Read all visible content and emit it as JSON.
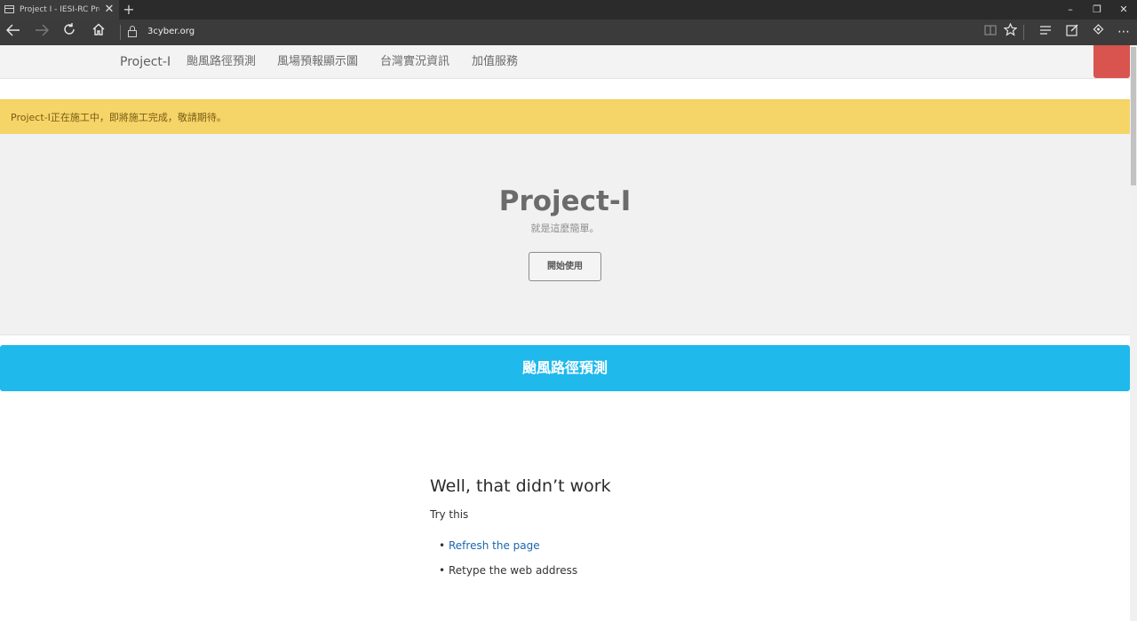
{
  "browser": {
    "tab_title": "Project I - IESI-RC Produ",
    "tab_close": "✕",
    "new_tab": "+",
    "url": "3cyber.org",
    "window_controls": {
      "minimize": "–",
      "restore": "❐",
      "close": "✕"
    },
    "icons": {
      "back": "🡐",
      "forward": "🡒",
      "refresh": "↻",
      "home": "⌂",
      "reading_view": "▯",
      "favorite": "☆",
      "hub": "≡",
      "web_note": "✎",
      "share": "⟲",
      "more": "⋯"
    }
  },
  "site_nav": {
    "brand": "Project-I",
    "items": [
      "颱風路徑預測",
      "風場預報顯示圖",
      "台灣實況資訊",
      "加值服務"
    ]
  },
  "alert": {
    "text": "Project-I正在施工中，即將施工完成，敬請期待。"
  },
  "hero": {
    "title": "Project-I",
    "subtitle": "就是這麼簡單。",
    "button_label": "開始使用"
  },
  "typhoon_section": {
    "label": "颱風路徑預測"
  },
  "error": {
    "title": "Well, that didn’t work",
    "try_label": "Try this",
    "items": [
      "Refresh the page",
      "Retype the web address"
    ],
    "bullet": "•"
  },
  "colors": {
    "alert_bg": "#f5d568",
    "typhoon_bar": "#1fb9ec",
    "nav_red": "#d9534f",
    "link": "#1a66b0"
  }
}
